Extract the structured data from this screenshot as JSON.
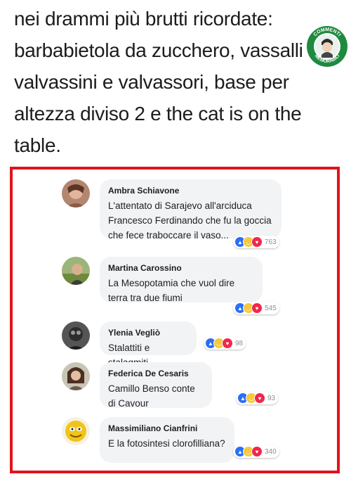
{
  "headline": "nei drammi più brutti ricordate: barbabietola da zucchero, vassalli valvassini e valvassori, base per altezza diviso 2 e the cat is on the table.",
  "logo": {
    "top_text": "COMMENTI",
    "bottom_text": "MEMORABILI",
    "color": "#1e8a3f"
  },
  "frame_color": "#e0141b",
  "comments": [
    {
      "name": "Ambra Schiavone",
      "text": "L'attentato di Sarajevo all'arciduca Francesco Ferdinando che fu la goccia che fece traboccare il vaso...",
      "reactions": [
        "like",
        "haha",
        "love"
      ],
      "count": "763"
    },
    {
      "name": "Martina Carossino",
      "text": "La Mesopotamia che vuol dire terra tra due fiumi",
      "reactions": [
        "like",
        "haha",
        "love"
      ],
      "count": "545"
    },
    {
      "name": "Ylenia Vegliò",
      "text": "Stalattiti e stalagmiti",
      "reactions": [
        "like",
        "haha",
        "love"
      ],
      "count": "98"
    },
    {
      "name": "Federica De Cesaris",
      "text": "Camillo Benso conte di Cavour",
      "reactions": [
        "like",
        "haha",
        "love"
      ],
      "count": "93"
    },
    {
      "name": "Massimiliano Cianfrini",
      "text": "E la fotosintesi clorofilliana?",
      "reactions": [
        "like",
        "haha",
        "love"
      ],
      "count": "340"
    }
  ]
}
